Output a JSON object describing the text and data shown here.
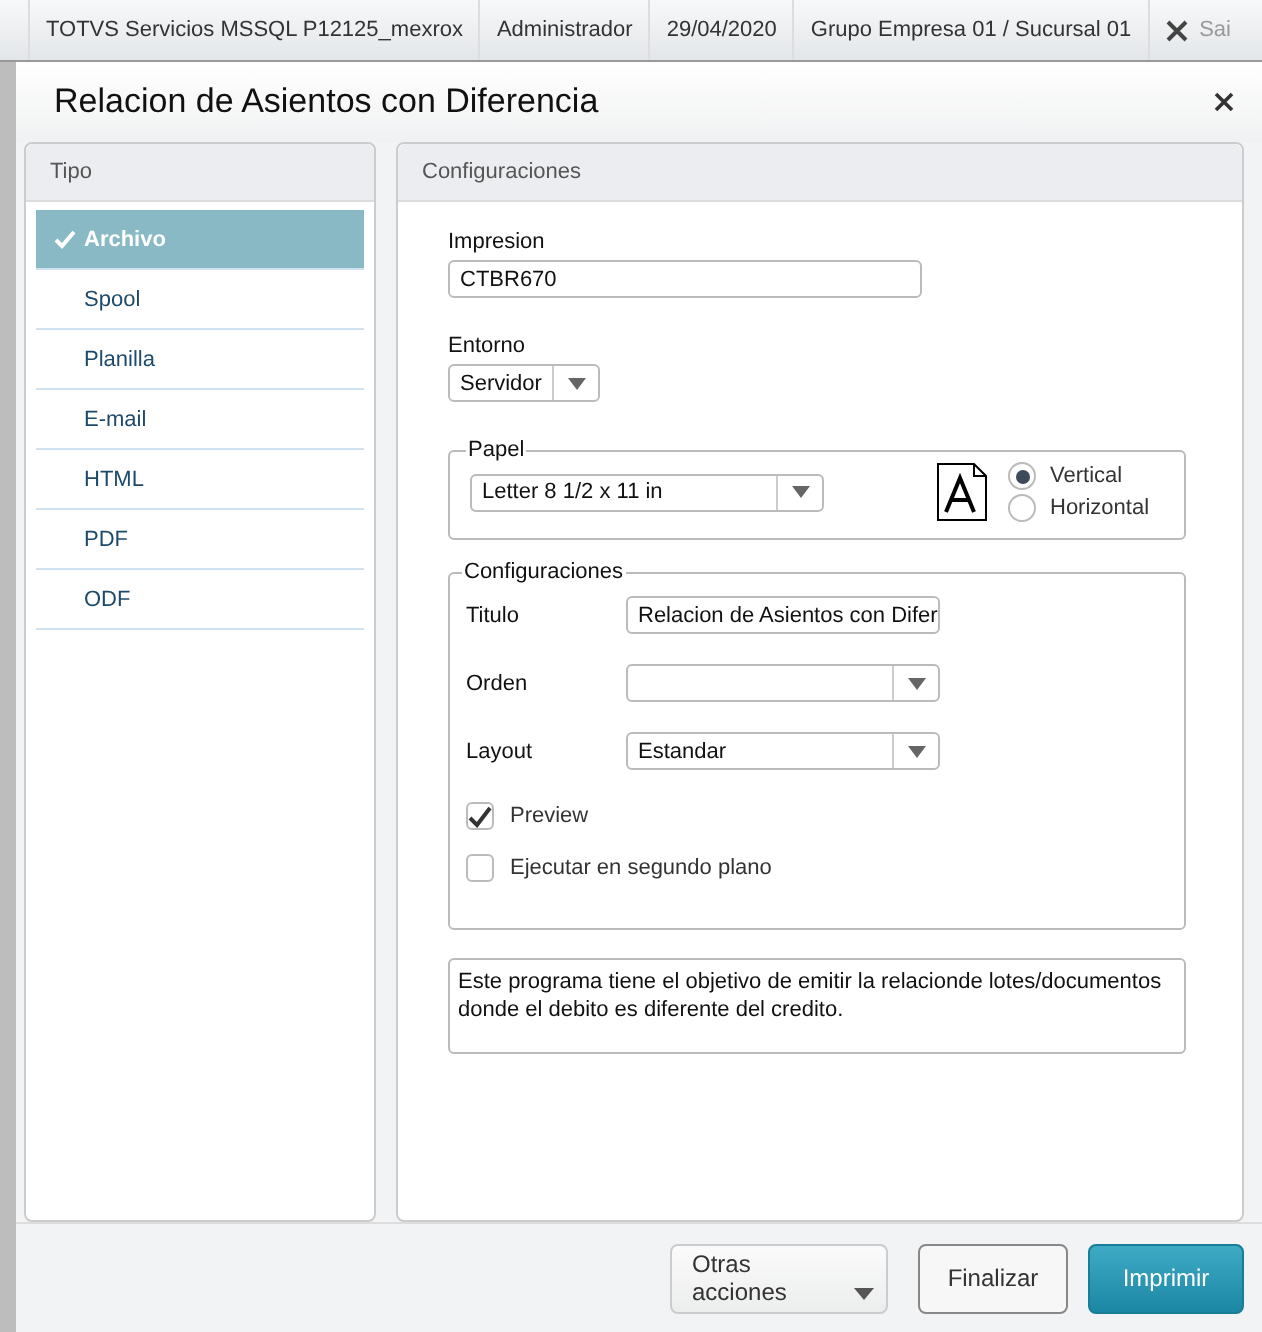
{
  "top_bar": {
    "items": [
      "TOTVS Servicios MSSQL P12125_mexrox",
      "Administrador",
      "29/04/2020",
      "Grupo Empresa 01 / Sucursal 01"
    ],
    "exit_label": "Sai"
  },
  "dialog": {
    "title": "Relacion de Asientos con Diferencia"
  },
  "sidebar": {
    "title": "Tipo",
    "items": [
      {
        "label": "Archivo",
        "selected": true
      },
      {
        "label": "Spool",
        "selected": false
      },
      {
        "label": "Planilla",
        "selected": false
      },
      {
        "label": "E-mail",
        "selected": false
      },
      {
        "label": "HTML",
        "selected": false
      },
      {
        "label": "PDF",
        "selected": false
      },
      {
        "label": "ODF",
        "selected": false
      }
    ]
  },
  "config": {
    "title": "Configuraciones",
    "impresion_label": "Impresion",
    "impresion_value": "CTBR670",
    "entorno_label": "Entorno",
    "entorno_value": "Servidor",
    "papel": {
      "legend": "Papel",
      "size": "Letter 8 1/2 x 11 in",
      "orientations": [
        {
          "label": "Vertical",
          "selected": true
        },
        {
          "label": "Horizontal",
          "selected": false
        }
      ]
    },
    "settings": {
      "legend": "Configuraciones",
      "titulo_label": "Titulo",
      "titulo_value": "Relacion de Asientos con Difer",
      "orden_label": "Orden",
      "layout_label": "Layout",
      "layout_value": "Estandar",
      "checks": [
        {
          "label": "Preview",
          "checked": true
        },
        {
          "label": "Ejecutar en segundo plano",
          "checked": false
        }
      ]
    },
    "description": "Este programa tiene el objetivo de emitir la relacionde lotes/documentos donde el debito es diferente del credito."
  },
  "buttons": [
    {
      "label": "Otras acciones",
      "kind": "menu"
    },
    {
      "label": "Finalizar",
      "kind": "plain"
    },
    {
      "label": "Imprimir",
      "kind": "primary"
    }
  ]
}
